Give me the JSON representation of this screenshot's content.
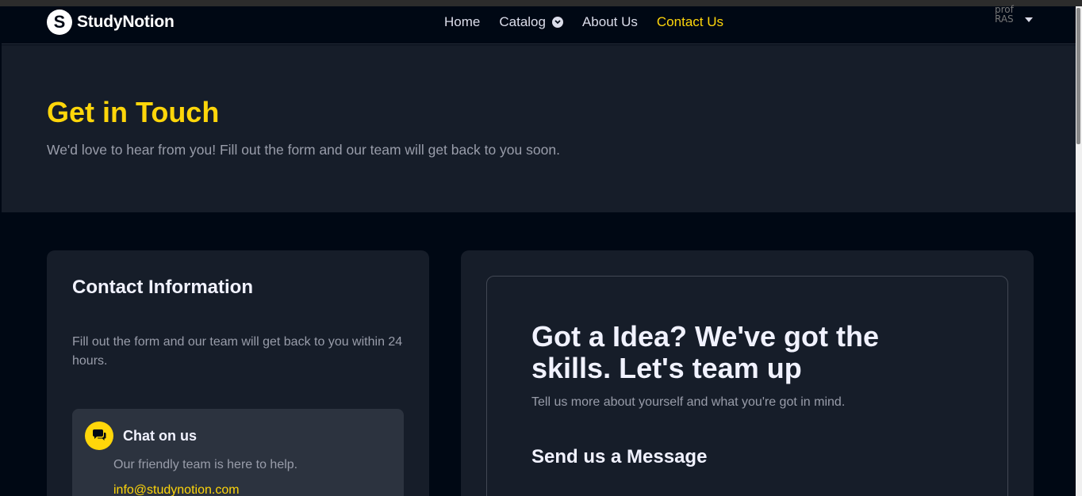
{
  "nav": {
    "logo_letter": "S",
    "logo_text": "StudyNotion",
    "links": [
      "Home",
      "Catalog",
      "About Us",
      "Contact Us"
    ],
    "active": "Contact Us",
    "profile_alt": "prof RAS"
  },
  "hero": {
    "title": "Get in Touch",
    "subtitle": "We'd love to hear from you! Fill out the form and our team will get back to you soon."
  },
  "contact_info": {
    "title": "Contact Information",
    "description": "Fill out the form and our team will get back to you within 24 hours.",
    "chat": {
      "title": "Chat on us",
      "subtitle": "Our friendly team is here to help.",
      "email": "info@studynotion.com"
    }
  },
  "form_card": {
    "title": "Got a Idea? We've got the skills. Let's team up",
    "subtitle": "Tell us more about yourself and what you're got in mind.",
    "send_title": "Send us a Message"
  },
  "colors": {
    "accent": "#FFD60A",
    "background": "#000814",
    "card": "#161D29",
    "chat_box": "#2C333F"
  }
}
